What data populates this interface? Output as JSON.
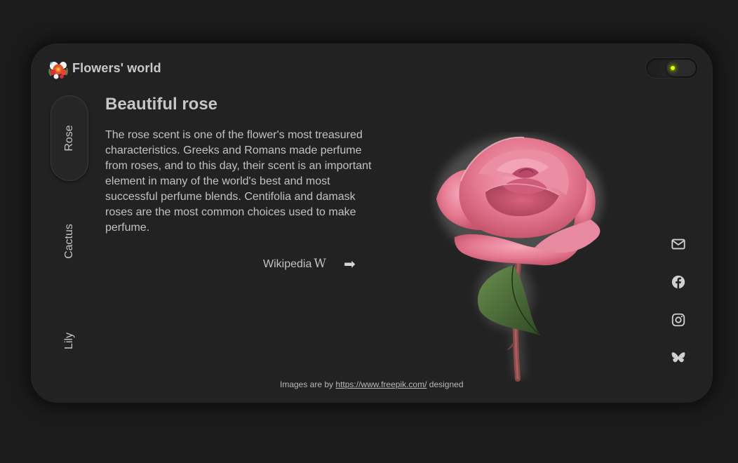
{
  "brand": {
    "name": "Flowers' world",
    "logo_icon": "flower-bouquet-icon"
  },
  "theme_toggle": {
    "state": "on",
    "indicator_color": "#e8ff00"
  },
  "side_nav": [
    {
      "label": "Rose",
      "active": true
    },
    {
      "label": "Cactus",
      "active": false
    },
    {
      "label": "Lily",
      "active": false
    }
  ],
  "main": {
    "title": "Beautiful rose",
    "description": "The rose scent is one of the flower's most treasured characteristics. Greeks and Romans made perfume from roses, and to this day, their scent is an important element in many of the world's best and most successful perfume blends. Centifolia and damask roses are the most common choices used to make perfume.",
    "link_label": "Wikipedia",
    "link_icon": "wikipedia-w-icon",
    "link_glyph": "W",
    "arrow_icon": "arrow-right-icon",
    "arrow_glyph": "➡"
  },
  "image": {
    "subject": "pink-rose-image"
  },
  "social": [
    {
      "icon": "envelope-icon"
    },
    {
      "icon": "facebook-icon"
    },
    {
      "icon": "instagram-icon"
    },
    {
      "icon": "bluesky-butterfly-icon"
    }
  ],
  "footer": {
    "prefix": "Images are by",
    "link": "https://www.freepik.com/",
    "suffix": "designed"
  },
  "colors": {
    "background": "#1b1b1b",
    "card": "#222222",
    "text": "#c2c2c2",
    "rose": "#e57a92",
    "leaf": "#4e6b3a"
  }
}
